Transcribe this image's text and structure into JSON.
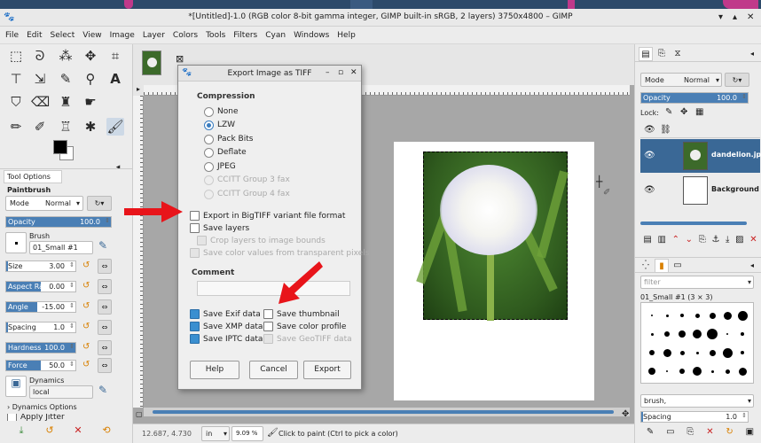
{
  "window": {
    "title": "*[Untitled]-1.0 (RGB color 8-bit gamma integer, GIMP built-in sRGB, 2 layers) 3750x4800 – GIMP"
  },
  "menu": [
    "File",
    "Edit",
    "Select",
    "View",
    "Image",
    "Layer",
    "Colors",
    "Tools",
    "Filters",
    "Cyan",
    "Windows",
    "Help"
  ],
  "toolbox": {
    "tab_label": "Tool Options",
    "tool_name": "Paintbrush",
    "mode_label": "Mode",
    "mode_value": "Normal",
    "opacity": {
      "label": "Opacity",
      "value": "100.0"
    },
    "brush_label": "Brush",
    "brush_value": "01_Small #1",
    "size": {
      "label": "Size",
      "value": "3.00"
    },
    "aspect": {
      "label": "Aspect Ratio",
      "value": "0.00"
    },
    "angle": {
      "label": "Angle",
      "value": "-15.00"
    },
    "spacing": {
      "label": "Spacing",
      "value": "1.0"
    },
    "hardness": {
      "label": "Hardness",
      "value": "100.0"
    },
    "force": {
      "label": "Force",
      "value": "50.0"
    },
    "dynamics_label": "Dynamics",
    "dynamics_value": "local",
    "dynamics_options": "Dynamics Options",
    "apply_jitter": "Apply Jitter"
  },
  "status": {
    "coords": "12.687, 4.730",
    "unit": "in",
    "zoom": "9.09 %",
    "message": "Click to paint (Ctrl to pick a color)"
  },
  "layers": {
    "mode_label": "Mode",
    "mode_value": "Normal",
    "opacity_label": "Opacity",
    "opacity_value": "100.0",
    "lock_label": "Lock:",
    "items": [
      {
        "name": "dandelion.jp"
      },
      {
        "name": "Background"
      }
    ]
  },
  "brushes": {
    "filter_placeholder": "filter",
    "current": "01_Small #1 (3 × 3)",
    "tag": "brush,",
    "spacing_label": "Spacing",
    "spacing_value": "1.0"
  },
  "dialog": {
    "title": "Export Image as TIFF",
    "compression_label": "Compression",
    "compression_options": [
      {
        "label": "None",
        "selected": false,
        "disabled": false
      },
      {
        "label": "LZW",
        "selected": true,
        "disabled": false
      },
      {
        "label": "Pack Bits",
        "selected": false,
        "disabled": false
      },
      {
        "label": "Deflate",
        "selected": false,
        "disabled": false
      },
      {
        "label": "JPEG",
        "selected": false,
        "disabled": false
      },
      {
        "label": "CCITT Group 3 fax",
        "selected": false,
        "disabled": true
      },
      {
        "label": "CCITT Group 4 fax",
        "selected": false,
        "disabled": true
      }
    ],
    "bigtiff": "Export in BigTIFF variant file format",
    "save_layers": "Save layers",
    "crop_layers": "Crop layers to image bounds",
    "save_color_values": "Save color values from transparent pixels",
    "comment_label": "Comment",
    "comment_value": "",
    "save_exif": "Save Exif data",
    "save_xmp": "Save XMP data",
    "save_iptc": "Save IPTC data",
    "save_thumbnail": "Save thumbnail",
    "save_color_profile": "Save color profile",
    "save_geotiff": "Save GeoTIFF data",
    "help": "Help",
    "cancel": "Cancel",
    "export": "Export"
  },
  "colors": {
    "accent": "#4a7fb5",
    "arrow": "#e8141a",
    "selected_layer": "#3a6896"
  }
}
